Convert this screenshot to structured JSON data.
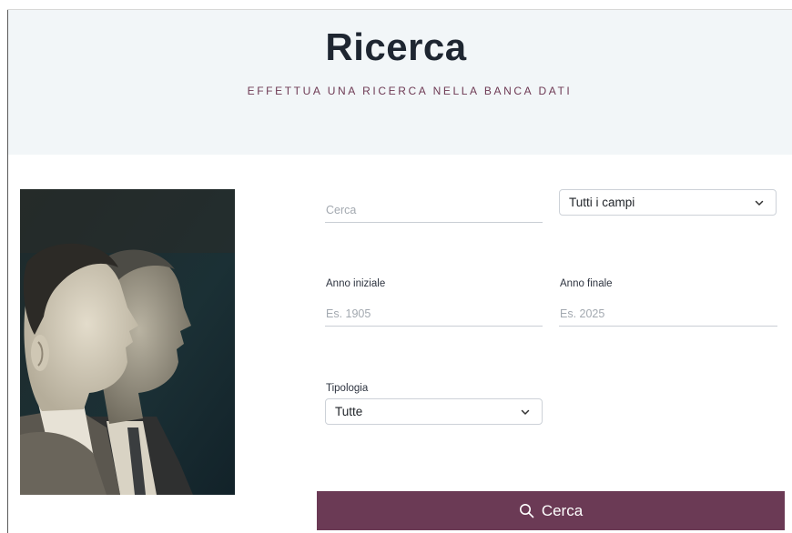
{
  "header": {
    "title": "Ricerca",
    "subtitle": "EFFETTUA UNA RICERCA NELLA BANCA DATI"
  },
  "search": {
    "placeholder": "Cerca",
    "field_select": {
      "selected": "Tutti i campi"
    }
  },
  "year_start": {
    "label": "Anno iniziale",
    "placeholder": "Es. 1905"
  },
  "year_end": {
    "label": "Anno finale",
    "placeholder": "Es. 2025"
  },
  "type": {
    "label": "Tipologia",
    "selected": "Tutte"
  },
  "submit": {
    "label": "Cerca"
  },
  "colors": {
    "header_bg": "#f2f6f8",
    "title": "#1e2631",
    "accent": "#6b3a55",
    "button_text": "#ffffff"
  },
  "icons": {
    "chevron": "chevron-down-icon",
    "search": "search-icon"
  }
}
